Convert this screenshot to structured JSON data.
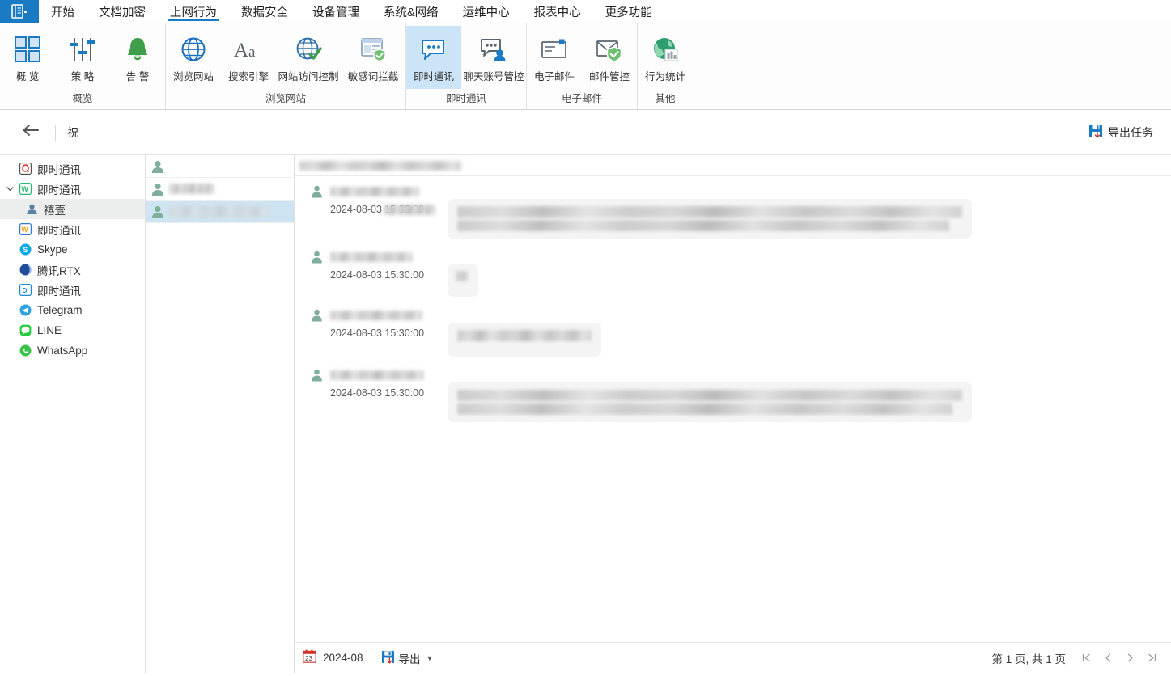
{
  "menu": {
    "logo_icon": "app-menu-icon",
    "items": [
      {
        "label": "开始",
        "active": false
      },
      {
        "label": "文档加密",
        "active": false
      },
      {
        "label": "上网行为",
        "active": true
      },
      {
        "label": "数据安全",
        "active": false
      },
      {
        "label": "设备管理",
        "active": false
      },
      {
        "label": "系统&网络",
        "active": false
      },
      {
        "label": "运维中心",
        "active": false
      },
      {
        "label": "报表中心",
        "active": false
      },
      {
        "label": "更多功能",
        "active": false
      }
    ]
  },
  "ribbon": {
    "groups": [
      {
        "title": "概览",
        "buttons": [
          {
            "label": "概 览",
            "icon": "grid-overview-icon",
            "selected": false
          },
          {
            "label": "策 略",
            "icon": "sliders-policy-icon",
            "selected": false
          },
          {
            "label": "告 警",
            "icon": "bell-alert-icon",
            "selected": false
          }
        ]
      },
      {
        "title": "浏览网站",
        "buttons": [
          {
            "label": "浏览网站",
            "icon": "globe-icon",
            "selected": false
          },
          {
            "label": "搜索引擎",
            "icon": "font-aa-icon",
            "selected": false
          },
          {
            "label": "网站访问控制",
            "icon": "globe-check-icon",
            "selected": false
          },
          {
            "label": "敏感词拦截",
            "icon": "page-shield-icon",
            "selected": false
          }
        ]
      },
      {
        "title": "即时通讯",
        "buttons": [
          {
            "label": "即时通讯",
            "icon": "chat-bubble-icon",
            "selected": true
          },
          {
            "label": "聊天账号管控",
            "icon": "chat-user-icon",
            "selected": false
          }
        ]
      },
      {
        "title": "电子邮件",
        "buttons": [
          {
            "label": "电子邮件",
            "icon": "mail-icon",
            "selected": false
          },
          {
            "label": "邮件管控",
            "icon": "mail-shield-icon",
            "selected": false
          }
        ]
      },
      {
        "title": "其他",
        "buttons": [
          {
            "label": "行为统计",
            "icon": "globe-chart-icon",
            "selected": false
          }
        ]
      }
    ]
  },
  "subheader": {
    "back_icon": "back-arrow-icon",
    "breadcrumb": "祝",
    "export_task_label": "导出任务",
    "export_task_icon": "export-pdf-icon"
  },
  "tree": {
    "items": [
      {
        "label": "即时通讯",
        "icon": "qq-icon",
        "icon_color": "#d93025",
        "depth": 0,
        "caret": "",
        "selected": false
      },
      {
        "label": "即时通讯",
        "icon": "wechat-work-icon",
        "icon_color": "#2eb872",
        "depth": 0,
        "caret": "expanded",
        "selected": false
      },
      {
        "label": "禧壹",
        "icon": "user-icon",
        "icon_color": "#5b7f9e",
        "depth": 1,
        "caret": "",
        "selected": true
      },
      {
        "label": "即时通讯",
        "icon": "wangwang-icon",
        "icon_color": "#f5a623",
        "depth": 0,
        "caret": "",
        "selected": false
      },
      {
        "label": "Skype",
        "icon": "skype-icon",
        "icon_color": "#0aa9e6",
        "depth": 0,
        "caret": "",
        "selected": false
      },
      {
        "label": "腾讯RTX",
        "icon": "rtx-icon",
        "icon_color": "#1f4e9c",
        "depth": 0,
        "caret": "",
        "selected": false
      },
      {
        "label": "即时通讯",
        "icon": "dingtalk-icon",
        "icon_color": "#1e88d8",
        "depth": 0,
        "caret": "",
        "selected": false
      },
      {
        "label": "Telegram",
        "icon": "telegram-icon",
        "icon_color": "#2aa3e0",
        "depth": 0,
        "caret": "",
        "selected": false
      },
      {
        "label": "LINE",
        "icon": "line-icon",
        "icon_color": "#27cc3f",
        "depth": 0,
        "caret": "",
        "selected": false
      },
      {
        "label": "WhatsApp",
        "icon": "whatsapp-icon",
        "icon_color": "#3ac34b",
        "depth": 0,
        "caret": "",
        "selected": false
      }
    ]
  },
  "contacts": {
    "rows": [
      {
        "redacted": true,
        "width": 0,
        "selected": false
      },
      {
        "redacted": true,
        "width": 56,
        "selected": false
      },
      {
        "redacted": true,
        "width": 124,
        "selected": true
      }
    ]
  },
  "chat": {
    "header_redacted": true,
    "messages": [
      {
        "sender_redacted": true,
        "sender_width": 110,
        "time": "2024-08-03 15:30:00",
        "time_partially_redacted": true,
        "bubble_width": 648,
        "bubble_height": 34,
        "bubble_lines": 2
      },
      {
        "sender_redacted": true,
        "sender_width": 102,
        "time": "2024-08-03 15:30:00",
        "time_partially_redacted": false,
        "bubble_width": 38,
        "bubble_height": 26,
        "bubble_lines": 1
      },
      {
        "sender_redacted": true,
        "sender_width": 114,
        "time": "2024-08-03 15:30:00",
        "time_partially_redacted": false,
        "bubble_width": 190,
        "bubble_height": 26,
        "bubble_lines": 2
      },
      {
        "sender_redacted": true,
        "sender_width": 116,
        "time": "2024-08-03 15:30:00",
        "time_partially_redacted": false,
        "bubble_width": 648,
        "bubble_height": 34,
        "bubble_lines": 2
      }
    ]
  },
  "footer": {
    "calendar_icon": "calendar-icon",
    "date_value": "2024-08",
    "export_label": "导出",
    "export_icon": "export-excel-icon",
    "pager_text": "第 1 页, 共 1 页",
    "first_label": "|<",
    "prev_label": "<",
    "next_label": ">",
    "last_label": ">|"
  },
  "colors": {
    "brand": "#1b7ac4",
    "ribbon_selected": "#cce4f7",
    "tree_selected": "#eceded",
    "contact_selected": "#cfe4f2",
    "bubble": "#f4f4f4"
  }
}
